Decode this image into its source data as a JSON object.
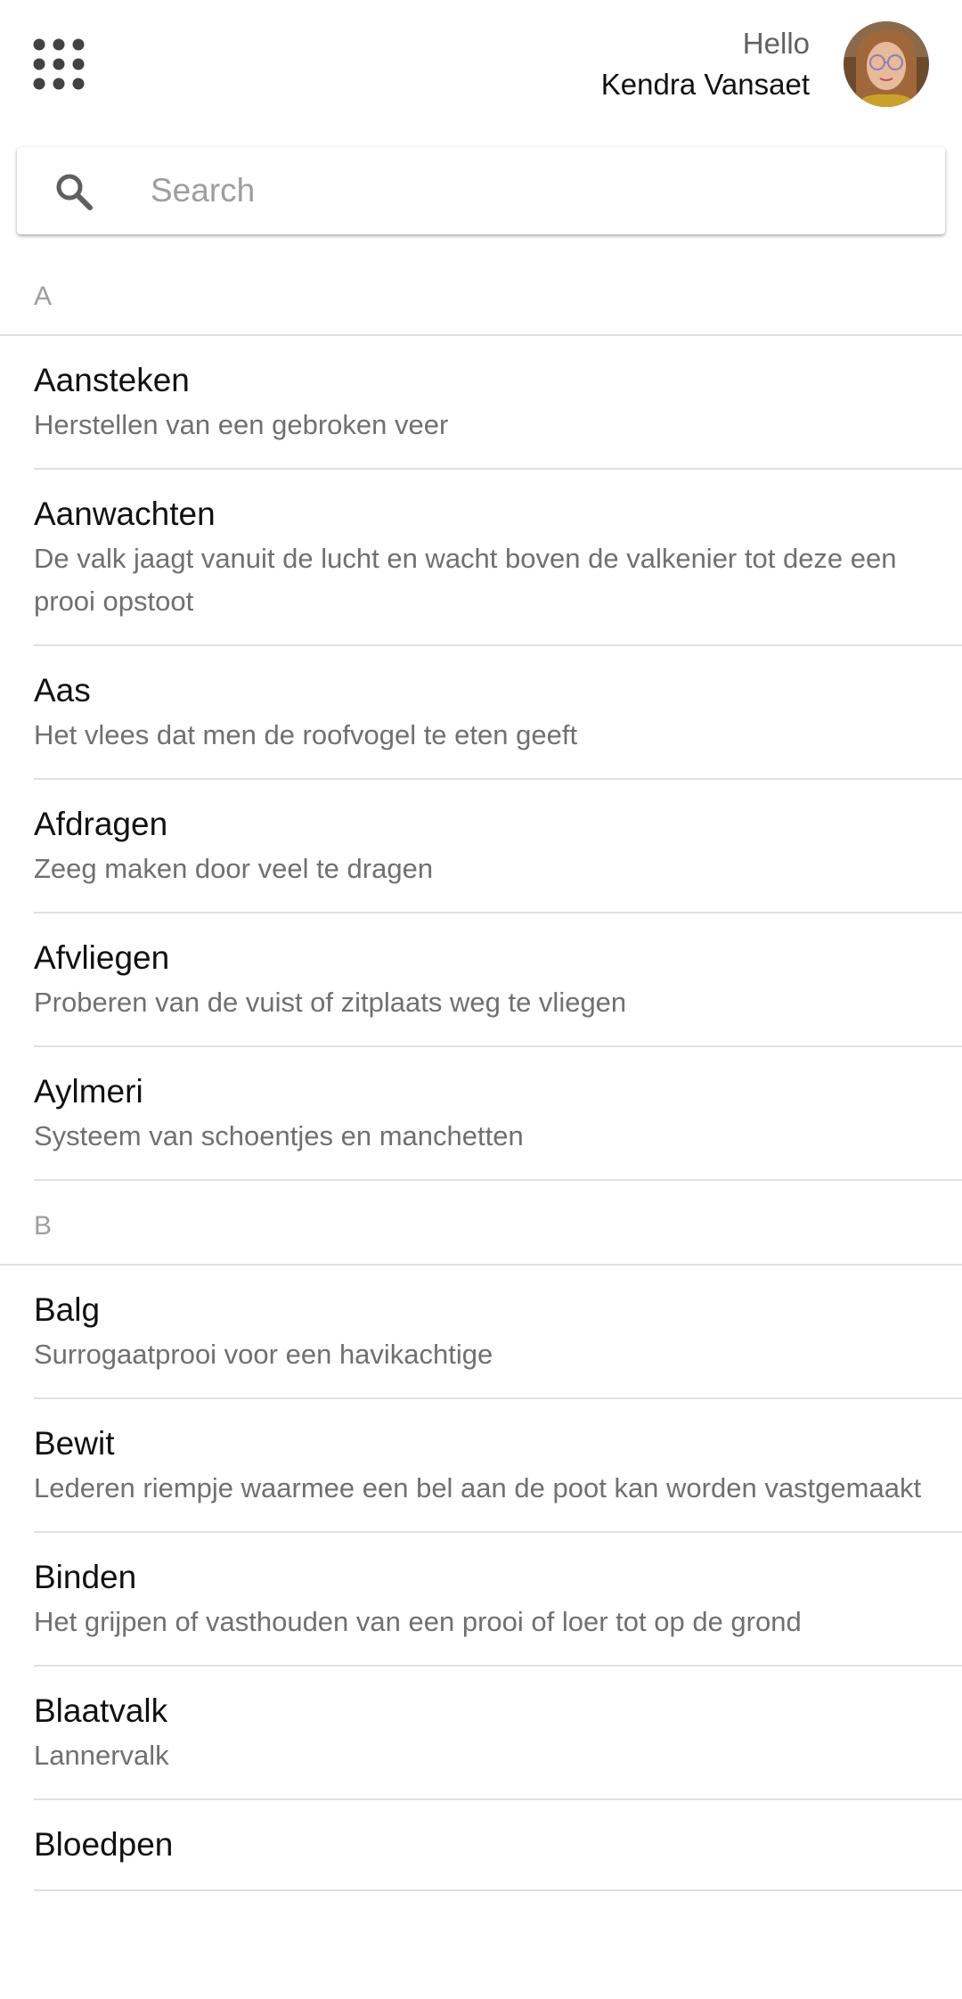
{
  "header": {
    "greeting": "Hello",
    "user_name": "Kendra Vansaet",
    "apps_icon": "apps-grid-icon",
    "avatar_icon": "user-avatar"
  },
  "search": {
    "placeholder": "Search",
    "value": ""
  },
  "sections": [
    {
      "letter": "A",
      "items": [
        {
          "term": "Aansteken",
          "definition": "Herstellen van een gebroken veer"
        },
        {
          "term": "Aanwachten",
          "definition": "De valk jaagt vanuit de lucht en wacht boven de valkenier tot deze een prooi opstoot"
        },
        {
          "term": "Aas",
          "definition": "Het vlees dat men de roofvogel te eten geeft"
        },
        {
          "term": "Afdragen",
          "definition": "Zeeg maken door veel te dragen"
        },
        {
          "term": "Afvliegen",
          "definition": "Proberen van de vuist of zitplaats weg te vliegen"
        },
        {
          "term": "Aylmeri",
          "definition": "Systeem van schoentjes en manchetten"
        }
      ]
    },
    {
      "letter": "B",
      "items": [
        {
          "term": "Balg",
          "definition": "Surrogaatprooi voor een havikachtige"
        },
        {
          "term": "Bewit",
          "definition": "Lederen riempje waarmee een bel aan de poot kan worden vastgemaakt"
        },
        {
          "term": "Binden",
          "definition": "Het grijpen of vasthouden van een prooi of loer tot op de grond"
        },
        {
          "term": "Blaatvalk",
          "definition": "Lannervalk"
        },
        {
          "term": "Bloedpen",
          "definition": ""
        }
      ]
    }
  ]
}
